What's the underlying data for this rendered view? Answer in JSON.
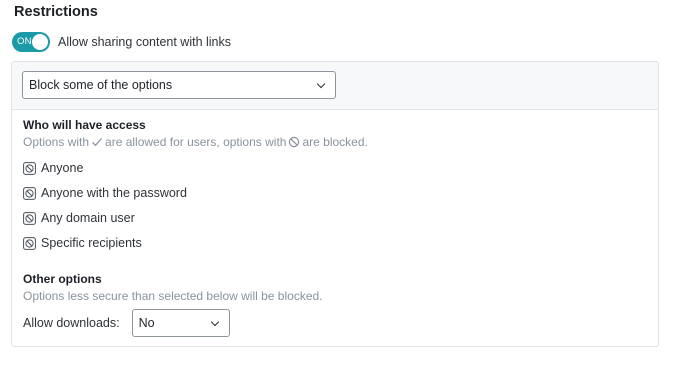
{
  "restrictions": {
    "heading": "Restrictions",
    "toggle": {
      "state_label": "ON",
      "label": "Allow sharing content with links",
      "on": true
    }
  },
  "mode_select": {
    "value": "Block some of the options"
  },
  "access": {
    "title": "Who will have access",
    "hint": {
      "part1": "Options with",
      "part2": "are allowed for users, options with",
      "part3": "are blocked."
    },
    "options": [
      {
        "label": "Anyone",
        "icon": "blocked-icon"
      },
      {
        "label": "Anyone with the password",
        "icon": "blocked-icon"
      },
      {
        "label": "Any domain user",
        "icon": "blocked-icon"
      },
      {
        "label": "Specific recipients",
        "icon": "blocked-icon"
      }
    ]
  },
  "other": {
    "title": "Other options",
    "hint": "Options less secure than selected below will be blocked.",
    "downloads": {
      "label": "Allow downloads:",
      "value": "No"
    }
  },
  "colors": {
    "accent": "#1a9aa6",
    "muted_text": "#8a939c",
    "panel_bg": "#f6f8fa"
  }
}
